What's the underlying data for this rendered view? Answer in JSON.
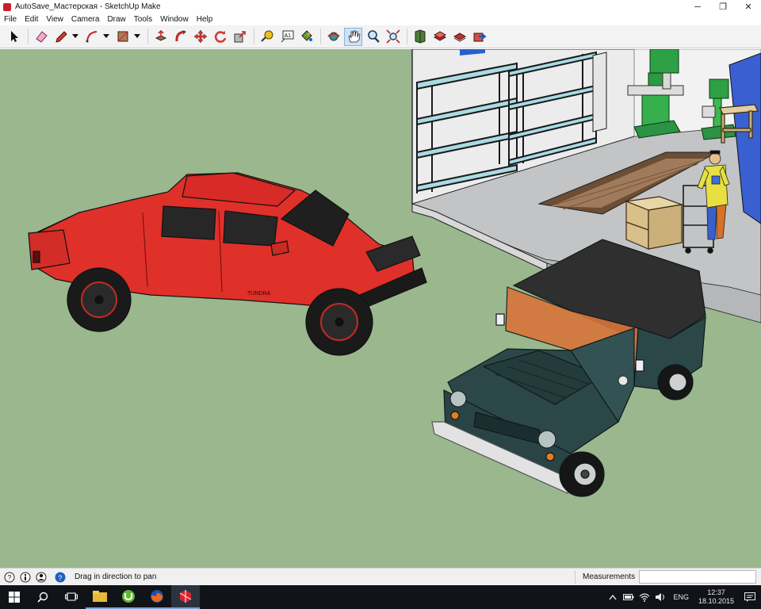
{
  "window": {
    "title": "AutoSave_Мастерская - SketchUp Make",
    "controls": {
      "minimize": "─",
      "maximize": "❐",
      "close": "✕"
    }
  },
  "menu": [
    "File",
    "Edit",
    "View",
    "Camera",
    "Draw",
    "Tools",
    "Window",
    "Help"
  ],
  "toolbar": {
    "tools": [
      "select-icon",
      "eraser-icon",
      "pencil-line-icon",
      "arc-icon",
      "rectangle-icon",
      "push-pull-icon",
      "follow-me-icon",
      "move-icon",
      "rotate-icon",
      "scale-icon",
      "tape-measure-icon",
      "text-icon",
      "paint-bucket-icon",
      "orbit-icon",
      "pan-icon",
      "zoom-icon",
      "zoom-extents-icon",
      "3d-warehouse-icon",
      "extension-warehouse-icon",
      "layout-icon",
      "share-model-icon"
    ],
    "active_tool": "pan-icon",
    "text_tool_label": "A1"
  },
  "scene": {
    "ground_color": "#9ab78e",
    "truck_color": "#e0302a",
    "jeep_color": "#2c4748",
    "truck_badge": "TUNDRA"
  },
  "statusbar": {
    "message": "Drag in direction to pan",
    "measurements_label": "Measurements",
    "measurements_value": ""
  },
  "taskbar": {
    "apps": [
      "windows-start-icon",
      "search-icon",
      "task-view-icon",
      "file-explorer-icon",
      "utorrent-icon",
      "firefox-icon",
      "sketchup-icon"
    ],
    "language": "ENG",
    "time": "12:37",
    "date": "18.10.2015"
  }
}
